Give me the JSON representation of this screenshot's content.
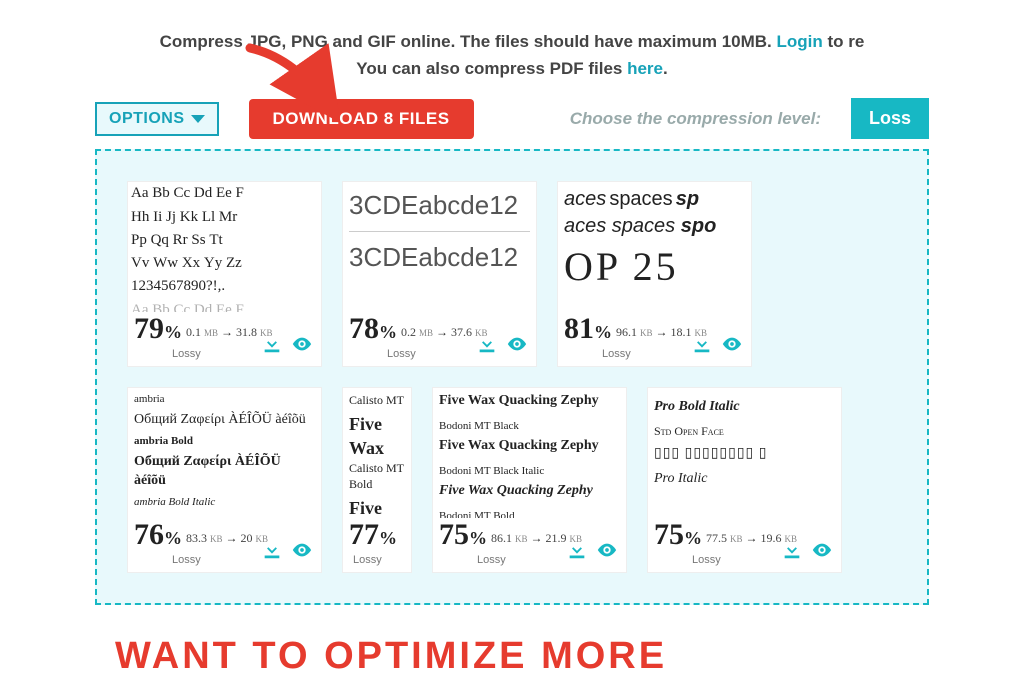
{
  "header": {
    "line1a": "Compress JPG, PNG and GIF online. The files should have maximum 10MB. ",
    "login": "Login",
    "line1b": " to re",
    "line2a": "You can also compress PDF files ",
    "here": "here",
    "line2b": "."
  },
  "toolbar": {
    "options": "OPTIONS",
    "download": "DOWNLOAD 8 FILES",
    "choose": "Choose the compression level:",
    "lossy": "Loss"
  },
  "cards": [
    {
      "percent": "79",
      "size_from": "0.1",
      "unit_from": "MB",
      "size_to": "31.8",
      "unit_to": "KB",
      "mode": "Lossy"
    },
    {
      "percent": "78",
      "size_from": "0.2",
      "unit_from": "MB",
      "size_to": "37.6",
      "unit_to": "KB",
      "mode": "Lossy"
    },
    {
      "percent": "81",
      "size_from": "96.1",
      "unit_from": "KB",
      "size_to": "18.1",
      "unit_to": "KB",
      "mode": "Lossy"
    },
    {
      "percent": "76",
      "size_from": "83.3",
      "unit_from": "KB",
      "size_to": "20",
      "unit_to": "KB",
      "mode": "Lossy"
    },
    {
      "percent": "77",
      "size_from": "",
      "unit_from": "",
      "size_to": "",
      "unit_to": "",
      "mode": "Lossy"
    },
    {
      "percent": "75",
      "size_from": "86.1",
      "unit_from": "KB",
      "size_to": "21.9",
      "unit_to": "KB",
      "mode": "Lossy"
    },
    {
      "percent": "75",
      "size_from": "77.5",
      "unit_from": "KB",
      "size_to": "19.6",
      "unit_to": "KB",
      "mode": "Lossy"
    }
  ],
  "cta": "WANT TO OPTIMIZE MORE",
  "percent_sign": "%"
}
